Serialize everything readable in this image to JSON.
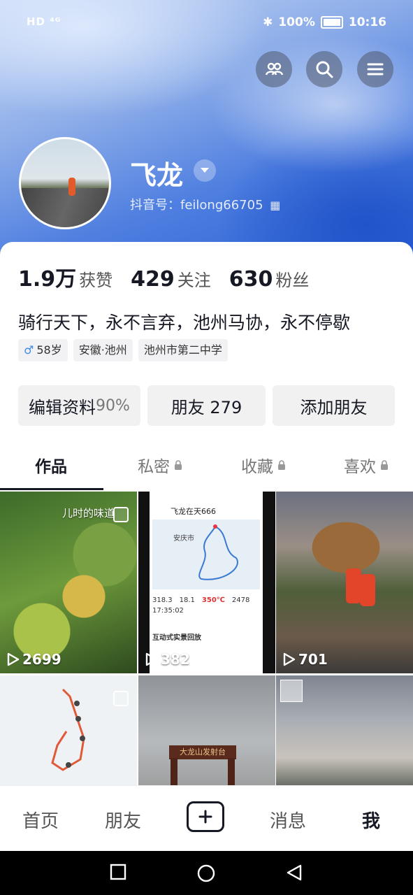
{
  "status_bar": {
    "left": "HD ⁴ᴳ",
    "battery": "100%",
    "time": "10:16"
  },
  "profile": {
    "name": "飞龙",
    "douyin_id": "抖音号：feilong66705",
    "bio": "骑行天下，永不言弃，池州马协，永不停歇",
    "tags": [
      "58岁",
      "安徽·池州",
      "池州市第二中学"
    ]
  },
  "stats": [
    {
      "num": "1.9万",
      "label": "获赞"
    },
    {
      "num": "429",
      "label": "关注"
    },
    {
      "num": "630",
      "label": "粉丝"
    }
  ],
  "actions": {
    "edit": "编辑资料",
    "edit_pct": "90%",
    "friends": "朋友 279",
    "add": "添加朋友"
  },
  "tabs": [
    "作品",
    "私密",
    "收藏",
    "喜欢"
  ],
  "videos": [
    {
      "plays": "2699",
      "caption": "儿时的味道"
    },
    {
      "plays": "382"
    },
    {
      "plays": "701"
    }
  ],
  "map_thumb": {
    "header": "飞龙在天666",
    "metrics": [
      "318.3",
      "18.1",
      "2478",
      "17:35:02",
      "350℃"
    ],
    "place": "安庆市",
    "banner": "互动式实景回放"
  },
  "sign_text": "大龙山发射台",
  "nav": [
    "首页",
    "朋友",
    "消息",
    "我"
  ]
}
